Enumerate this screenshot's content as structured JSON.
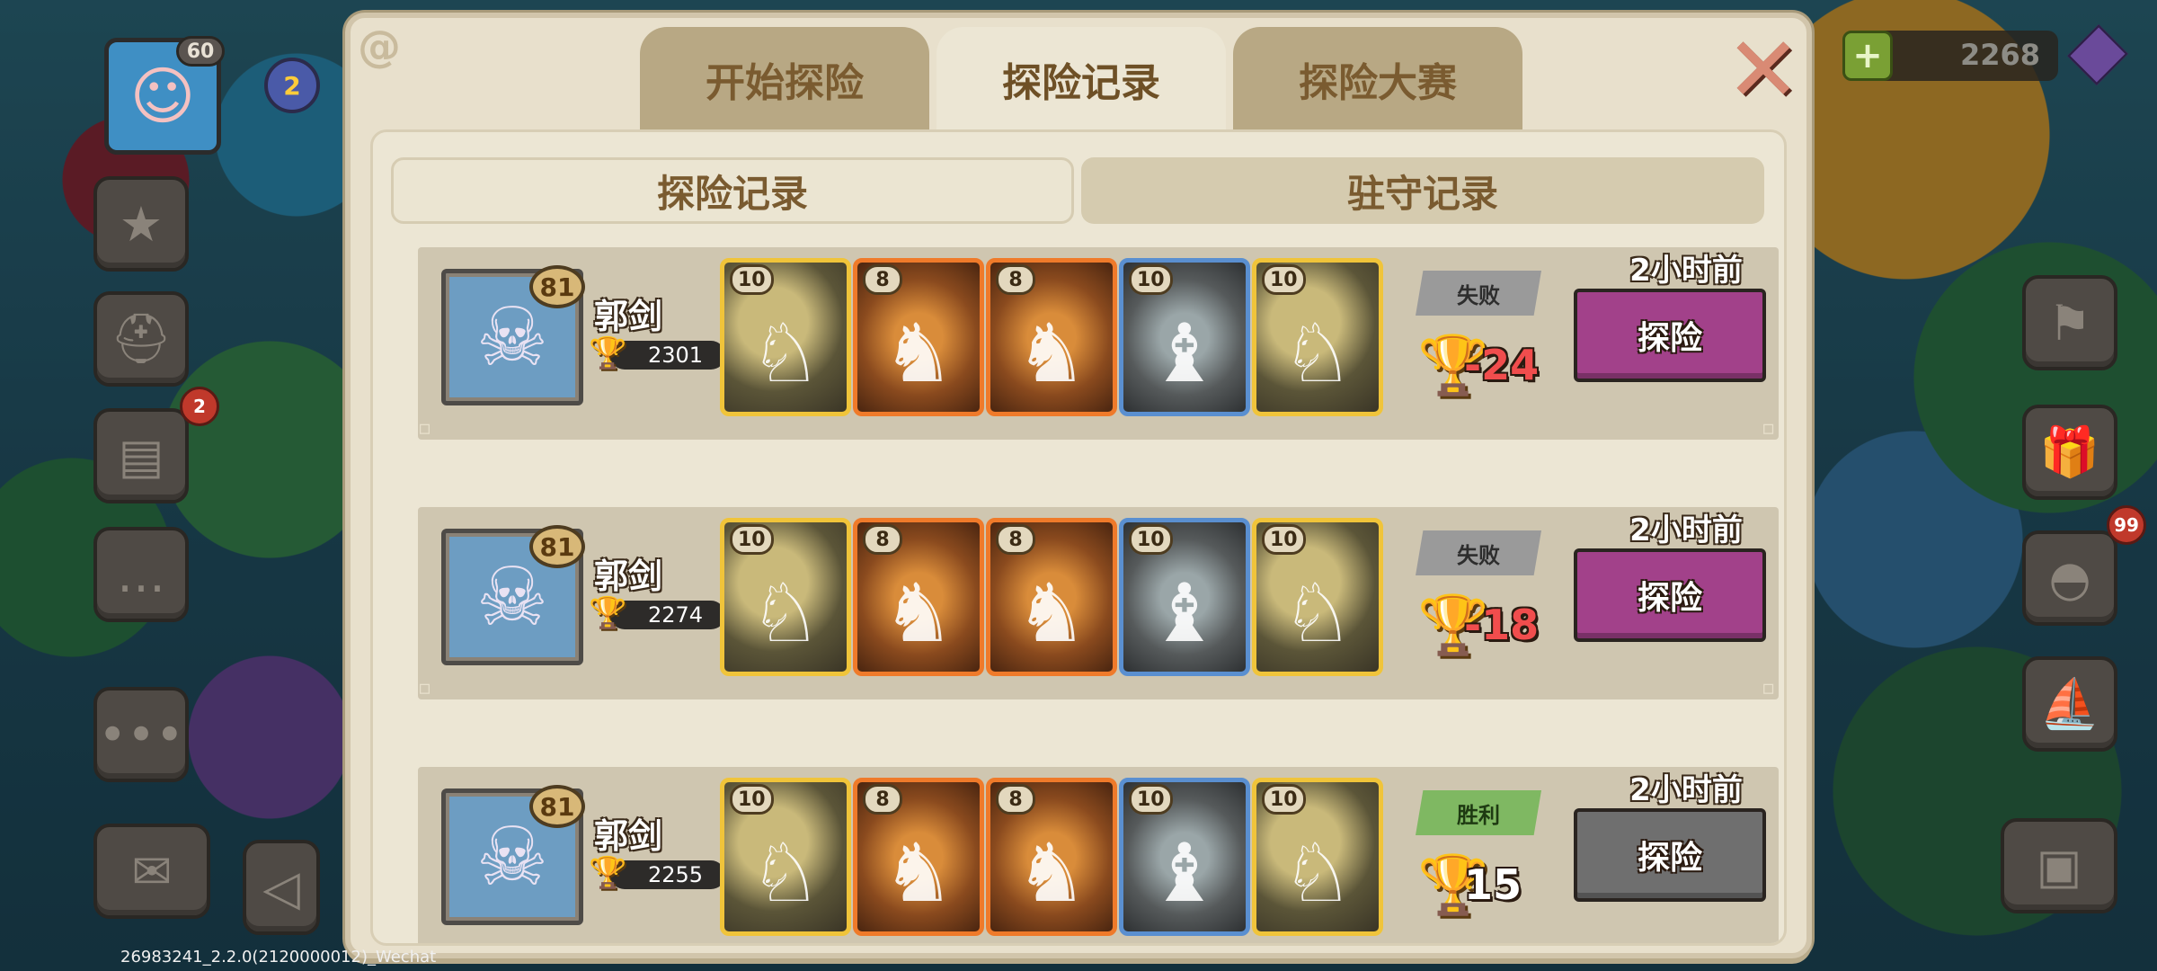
{
  "hud": {
    "player_level": "60",
    "star_level": "2",
    "book_badge": "2",
    "egg_badge": "99",
    "currency_amount": "2268"
  },
  "top_tabs": [
    {
      "label": "开始探险",
      "active": false
    },
    {
      "label": "探险记录",
      "active": true
    },
    {
      "label": "探险大赛",
      "active": false
    }
  ],
  "sub_tabs": [
    {
      "label": "探险记录",
      "active": true
    },
    {
      "label": "驻守记录",
      "active": false
    }
  ],
  "records": [
    {
      "player_name": "郭剑",
      "player_level": "81",
      "trophies": "2301",
      "pets": [
        {
          "level": "10",
          "rarity": "gold"
        },
        {
          "level": "8",
          "rarity": "orange"
        },
        {
          "level": "8",
          "rarity": "orange"
        },
        {
          "level": "10",
          "rarity": "blue"
        },
        {
          "level": "10",
          "rarity": "gold"
        }
      ],
      "result": "失败",
      "result_type": "lose",
      "trophy_change": "-24",
      "time": "2小时前",
      "action": "探险",
      "action_enabled": true
    },
    {
      "player_name": "郭剑",
      "player_level": "81",
      "trophies": "2274",
      "pets": [
        {
          "level": "10",
          "rarity": "gold"
        },
        {
          "level": "8",
          "rarity": "orange"
        },
        {
          "level": "8",
          "rarity": "orange"
        },
        {
          "level": "10",
          "rarity": "blue"
        },
        {
          "level": "10",
          "rarity": "gold"
        }
      ],
      "result": "失败",
      "result_type": "lose",
      "trophy_change": "-18",
      "time": "2小时前",
      "action": "探险",
      "action_enabled": true
    },
    {
      "player_name": "郭剑",
      "player_level": "81",
      "trophies": "2255",
      "pets": [
        {
          "level": "10",
          "rarity": "gold"
        },
        {
          "level": "8",
          "rarity": "orange"
        },
        {
          "level": "8",
          "rarity": "orange"
        },
        {
          "level": "10",
          "rarity": "blue"
        },
        {
          "level": "10",
          "rarity": "gold"
        }
      ],
      "result": "胜利",
      "result_type": "win",
      "trophy_change": "15",
      "time": "2小时前",
      "action": "探险",
      "action_enabled": false
    }
  ],
  "version": "26983241_2.2.0(2120000012)_Wechat",
  "colors": {
    "action_active": "#a2418a",
    "action_disabled": "#6f6f6f",
    "loss_text": "#f04d4d",
    "win_banner": "#7fb862",
    "lose_banner": "#9a9a9a"
  }
}
